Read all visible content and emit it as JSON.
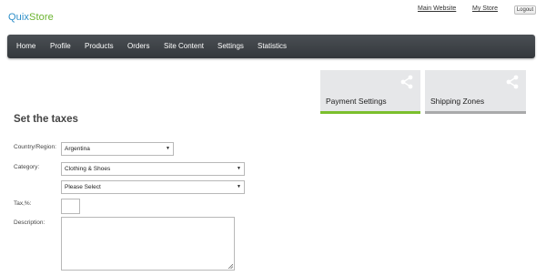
{
  "brand": {
    "quix": "Quix",
    "store": "Store"
  },
  "header": {
    "main_website": "Main Website",
    "my_store": "My Store",
    "logout": "Logout"
  },
  "nav": {
    "items": [
      "Home",
      "Profile",
      "Products",
      "Orders",
      "Site Content",
      "Settings",
      "Statistics"
    ]
  },
  "tiles": {
    "payment": {
      "label": "Payment Settings",
      "icon": "share-icon",
      "accent": "#7bbf2d"
    },
    "shipping": {
      "label": "Shipping Zones",
      "icon": "share-icon",
      "accent": "#a9aaab"
    }
  },
  "form": {
    "title": "Set the taxes",
    "country_label": "Country/Region:",
    "country_value": "Argentina",
    "category_label": "Category:",
    "category_value": "Clothing & Shoes",
    "subcategory_value": "Please Select",
    "tax_label": "Tax,%:",
    "tax_value": "",
    "description_label": "Description:",
    "description_value": ""
  },
  "colors": {
    "brand_blue": "#2c8ec8",
    "brand_green": "#6ab32e",
    "nav_bg": "#3d4246"
  }
}
